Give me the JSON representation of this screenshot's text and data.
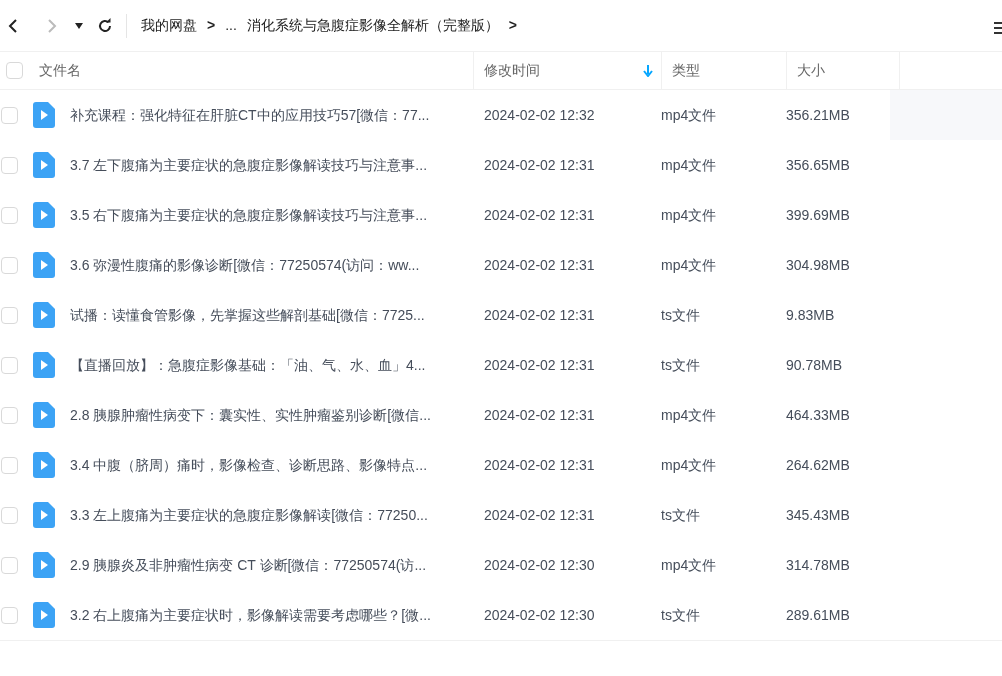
{
  "toolbar": {
    "back_enabled": true,
    "forward_enabled": false,
    "breadcrumb": [
      {
        "label": "我的网盘",
        "kind": "link"
      },
      {
        "label": ">",
        "kind": "separator"
      },
      {
        "label": "...",
        "kind": "link"
      },
      {
        "label": "消化系统与急腹症影像全解析（完整版）",
        "kind": "link"
      },
      {
        "label": ">",
        "kind": "separator"
      }
    ]
  },
  "table": {
    "columns": [
      {
        "label": "文件名",
        "sorted": false
      },
      {
        "label": "修改时间",
        "sorted": true
      },
      {
        "label": "类型",
        "sorted": false
      },
      {
        "label": "大小",
        "sorted": false
      }
    ],
    "header_checked": false,
    "rows": [
      {
        "name": "补充课程：强化特征在肝脏CT中的应用技巧57[微信：77...",
        "modified": "2024-02-02 12:32",
        "type": "mp4文件",
        "size": "356.21MB",
        "checked": false,
        "hovered": true
      },
      {
        "name": "3.7 左下腹痛为主要症状的急腹症影像解读技巧与注意事...",
        "modified": "2024-02-02 12:31",
        "type": "mp4文件",
        "size": "356.65MB",
        "checked": false,
        "hovered": false
      },
      {
        "name": "3.5 右下腹痛为主要症状的急腹症影像解读技巧与注意事...",
        "modified": "2024-02-02 12:31",
        "type": "mp4文件",
        "size": "399.69MB",
        "checked": false,
        "hovered": false
      },
      {
        "name": "3.6 弥漫性腹痛的影像诊断[微信：77250574(访问：ww...",
        "modified": "2024-02-02 12:31",
        "type": "mp4文件",
        "size": "304.98MB",
        "checked": false,
        "hovered": false
      },
      {
        "name": "试播：读懂食管影像，先掌握这些解剖基础[微信：7725...",
        "modified": "2024-02-02 12:31",
        "type": "ts文件",
        "size": "9.83MB",
        "checked": false,
        "hovered": false
      },
      {
        "name": "【直播回放】：急腹症影像基础：「油、气、水、血」4...",
        "modified": "2024-02-02 12:31",
        "type": "ts文件",
        "size": "90.78MB",
        "checked": false,
        "hovered": false
      },
      {
        "name": "2.8 胰腺肿瘤性病变下：囊实性、实性肿瘤鉴别诊断[微信...",
        "modified": "2024-02-02 12:31",
        "type": "mp4文件",
        "size": "464.33MB",
        "checked": false,
        "hovered": false
      },
      {
        "name": "3.4 中腹（脐周）痛时，影像检查、诊断思路、影像特点...",
        "modified": "2024-02-02 12:31",
        "type": "mp4文件",
        "size": "264.62MB",
        "checked": false,
        "hovered": false
      },
      {
        "name": "3.3 左上腹痛为主要症状的急腹症影像解读[微信：77250...",
        "modified": "2024-02-02 12:31",
        "type": "ts文件",
        "size": "345.43MB",
        "checked": false,
        "hovered": false
      },
      {
        "name": "2.9 胰腺炎及非肿瘤性病变 CT 诊断[微信：77250574(访...",
        "modified": "2024-02-02 12:30",
        "type": "mp4文件",
        "size": "314.78MB",
        "checked": false,
        "hovered": false
      },
      {
        "name": "3.2 右上腹痛为主要症状时，影像解读需要考虑哪些？[微...",
        "modified": "2024-02-02 12:30",
        "type": "ts文件",
        "size": "289.61MB",
        "checked": false,
        "hovered": false
      }
    ]
  }
}
